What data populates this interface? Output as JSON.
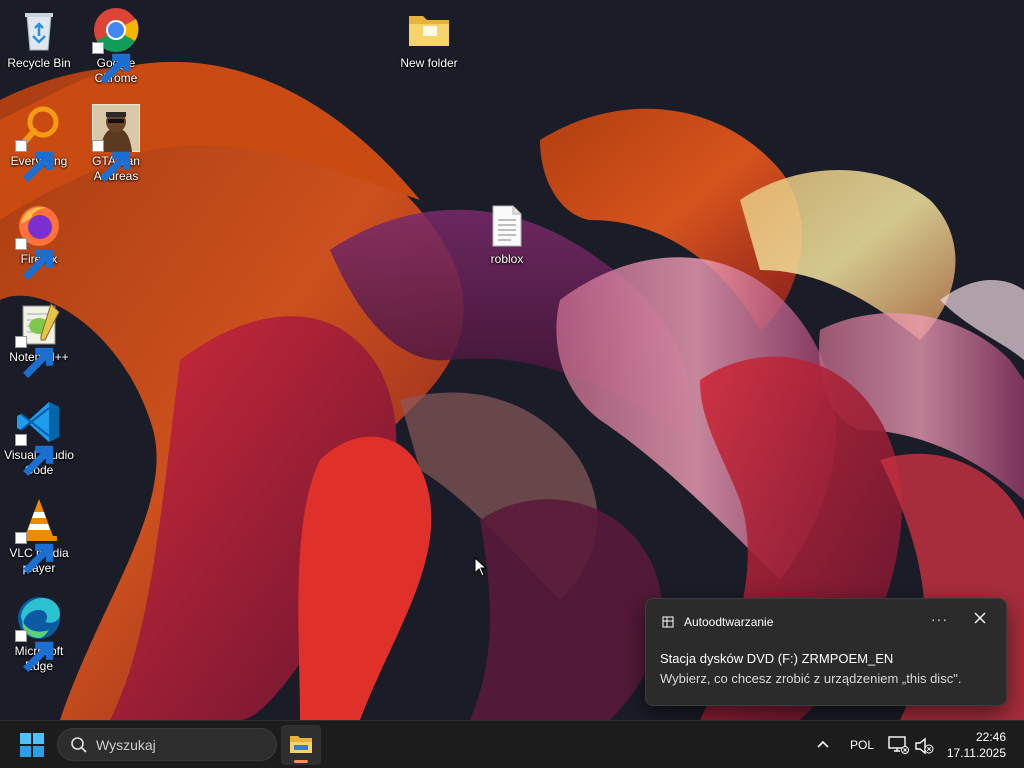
{
  "desktop": {
    "icons": [
      {
        "label": "Recycle Bin",
        "icon": "recycle-bin-icon"
      },
      {
        "label": "Google Chrome",
        "icon": "chrome-icon"
      },
      {
        "label": "New folder",
        "icon": "folder-icon"
      },
      {
        "label": "Everything",
        "icon": "everything-search-icon"
      },
      {
        "label": "GTA San Andreas",
        "icon": "gta-sa-icon"
      },
      {
        "label": "roblox",
        "icon": "text-file-icon"
      },
      {
        "label": "Firefox",
        "icon": "firefox-icon"
      },
      {
        "label": "Notepad++",
        "icon": "notepadpp-icon"
      },
      {
        "label": "Visual Studio Code",
        "icon": "vscode-icon"
      },
      {
        "label": "VLC media player",
        "icon": "vlc-icon"
      },
      {
        "label": "Microsoft Edge",
        "icon": "edge-icon"
      }
    ]
  },
  "notification": {
    "app_name": "Autoodtwarzanie",
    "more": "···",
    "title": "Stacja dysków DVD (F:) ZRMPOEM_EN",
    "body": "Wybierz, co chcesz zrobić z urządzeniem „this disc\"."
  },
  "taskbar": {
    "search_placeholder": "Wyszukaj",
    "language": "POL",
    "time": "22:46",
    "date": "17.11.2025"
  },
  "colors": {
    "taskbar_bg": "#1c1c1c",
    "toast_bg": "#2b2b2b",
    "accent": "#0078d4"
  }
}
